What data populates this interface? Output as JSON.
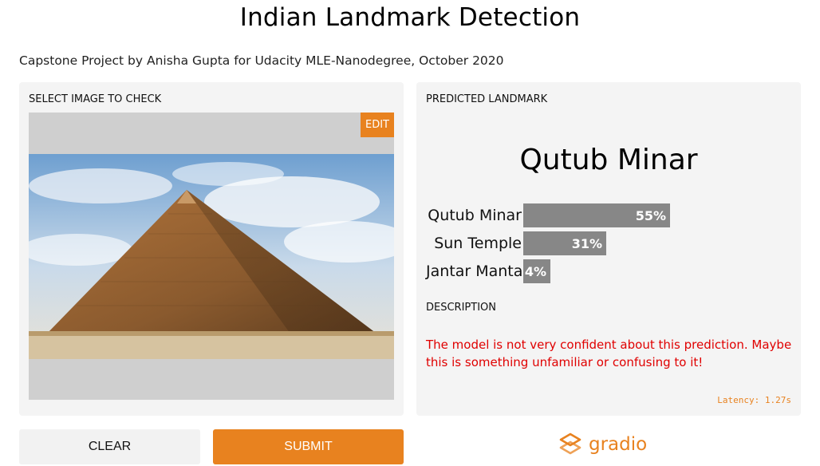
{
  "page": {
    "title": "Indian Landmark Detection",
    "subtitle": "Capstone Project by Anisha Gupta for Udacity MLE-Nanodegree, October 2020"
  },
  "input": {
    "label": "SELECT IMAGE TO CHECK",
    "edit_label": "EDIT",
    "image_subject": "pyramid photo under cloudy sky"
  },
  "output": {
    "label": "PREDICTED LANDMARK",
    "predicted": "Qutub Minar",
    "confidences": [
      {
        "name": "Qutub Minar",
        "pct_text": "55%",
        "value": 0.55
      },
      {
        "name": "Sun Temple",
        "pct_text": "31%",
        "value": 0.31
      },
      {
        "name": "Jantar Manta",
        "pct_text": "4%",
        "value": 0.04
      }
    ],
    "description_label": "DESCRIPTION",
    "description": "The model is not very confident about this prediction. Maybe this is something unfamiliar or confusing to it!",
    "latency": "Latency: 1.27s"
  },
  "actions": {
    "clear_label": "CLEAR",
    "submit_label": "SUBMIT"
  },
  "brand": {
    "name": "gradio",
    "accent": "#e8821f",
    "bar_color": "#878787",
    "warning_color": "#e00000"
  }
}
